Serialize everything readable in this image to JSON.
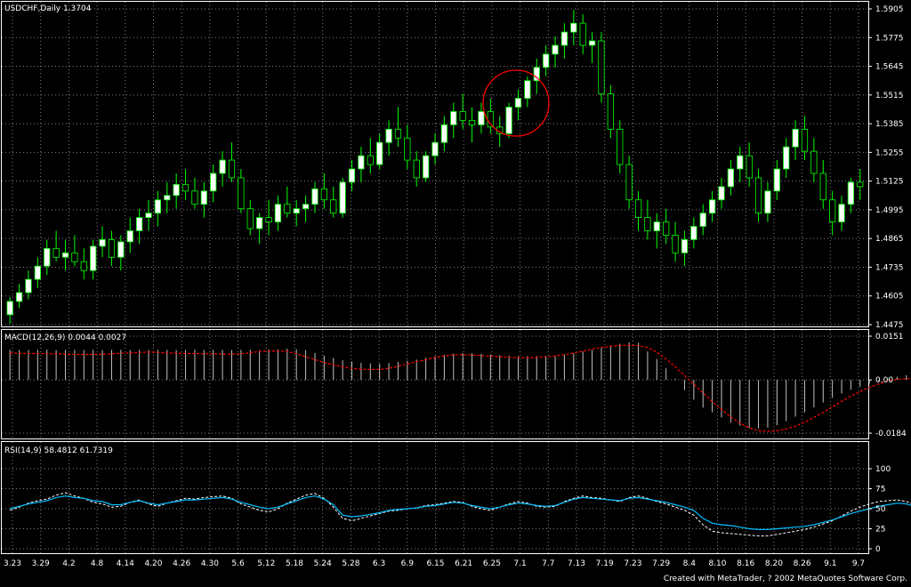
{
  "credit": "Created with MetaTrader, ? 2002 MetaQuotes Software Corp.",
  "colors": {
    "background": "#000000",
    "bull_candle": "#ffffff",
    "bear_candle": "#000000",
    "wick": "#00ff00",
    "grid": "#808080",
    "macd_histogram": "#c0c0c0",
    "macd_signal": "#ff0000",
    "rsi_line": "#00bfff",
    "rsi_signal": "#ffffff",
    "annotation_circle": "#ff0000"
  },
  "chart_data": [
    {
      "type": "candlestick",
      "label": "USDCHF,Daily  1.3704",
      "symbol": "USDCHF",
      "timeframe": "Daily",
      "last": "1.3704",
      "ylim": [
        1.4475,
        1.5905
      ],
      "y_ticks": [
        "1.5905",
        "1.5775",
        "1.5645",
        "1.5515",
        "1.5385",
        "1.5255",
        "1.5125",
        "1.4995",
        "1.4865",
        "1.4735",
        "1.4605",
        "1.4475"
      ],
      "x_ticks": [
        "3.23",
        "3.29",
        "4.2",
        "4.8",
        "4.14",
        "4.20",
        "4.26",
        "4.30",
        "5.6",
        "5.12",
        "5.18",
        "5.24",
        "5.28",
        "6.3",
        "6.9",
        "6.15",
        "6.21",
        "6.25",
        "7.1",
        "7.7",
        "7.13",
        "7.19",
        "7.23",
        "7.29",
        "8.4",
        "8.10",
        "8.16",
        "8.20",
        "8.26",
        "9.1",
        "9.7"
      ],
      "grid": true,
      "annotations": [
        {
          "shape": "circle",
          "around": "7.1"
        }
      ],
      "candles": [
        [
          1.452,
          1.46,
          1.448,
          1.458
        ],
        [
          1.458,
          1.466,
          1.455,
          1.462
        ],
        [
          1.462,
          1.472,
          1.459,
          1.468
        ],
        [
          1.468,
          1.478,
          1.464,
          1.474
        ],
        [
          1.474,
          1.486,
          1.47,
          1.482
        ],
        [
          1.482,
          1.49,
          1.476,
          1.478
        ],
        [
          1.478,
          1.486,
          1.472,
          1.48
        ],
        [
          1.48,
          1.488,
          1.474,
          1.476
        ],
        [
          1.476,
          1.482,
          1.468,
          1.472
        ],
        [
          1.472,
          1.486,
          1.468,
          1.483
        ],
        [
          1.483,
          1.492,
          1.478,
          1.486
        ],
        [
          1.486,
          1.49,
          1.474,
          1.478
        ],
        [
          1.478,
          1.488,
          1.472,
          1.485
        ],
        [
          1.485,
          1.496,
          1.48,
          1.49
        ],
        [
          1.49,
          1.5,
          1.484,
          1.496
        ],
        [
          1.496,
          1.504,
          1.49,
          1.498
        ],
        [
          1.498,
          1.508,
          1.492,
          1.504
        ],
        [
          1.504,
          1.512,
          1.498,
          1.506
        ],
        [
          1.506,
          1.516,
          1.5,
          1.511
        ],
        [
          1.511,
          1.518,
          1.504,
          1.508
        ],
        [
          1.508,
          1.514,
          1.5,
          1.502
        ],
        [
          1.502,
          1.512,
          1.496,
          1.508
        ],
        [
          1.508,
          1.52,
          1.503,
          1.516
        ],
        [
          1.516,
          1.526,
          1.51,
          1.522
        ],
        [
          1.522,
          1.53,
          1.512,
          1.514
        ],
        [
          1.514,
          1.518,
          1.498,
          1.5
        ],
        [
          1.5,
          1.504,
          1.488,
          1.491
        ],
        [
          1.491,
          1.498,
          1.484,
          1.496
        ],
        [
          1.496,
          1.504,
          1.488,
          1.494
        ],
        [
          1.494,
          1.506,
          1.49,
          1.502
        ],
        [
          1.502,
          1.51,
          1.496,
          1.498
        ],
        [
          1.498,
          1.504,
          1.492,
          1.5
        ],
        [
          1.5,
          1.506,
          1.494,
          1.502
        ],
        [
          1.502,
          1.512,
          1.498,
          1.509
        ],
        [
          1.509,
          1.516,
          1.5,
          1.504
        ],
        [
          1.504,
          1.51,
          1.496,
          1.498
        ],
        [
          1.498,
          1.514,
          1.496,
          1.512
        ],
        [
          1.512,
          1.522,
          1.508,
          1.518
        ],
        [
          1.518,
          1.528,
          1.512,
          1.524
        ],
        [
          1.524,
          1.532,
          1.516,
          1.52
        ],
        [
          1.52,
          1.534,
          1.518,
          1.53
        ],
        [
          1.53,
          1.54,
          1.524,
          1.536
        ],
        [
          1.536,
          1.546,
          1.528,
          1.532
        ],
        [
          1.532,
          1.538,
          1.518,
          1.522
        ],
        [
          1.522,
          1.526,
          1.51,
          1.514
        ],
        [
          1.514,
          1.526,
          1.512,
          1.524
        ],
        [
          1.524,
          1.534,
          1.52,
          1.53
        ],
        [
          1.53,
          1.542,
          1.526,
          1.538
        ],
        [
          1.538,
          1.548,
          1.532,
          1.544
        ],
        [
          1.544,
          1.552,
          1.536,
          1.54
        ],
        [
          1.54,
          1.546,
          1.53,
          1.538
        ],
        [
          1.538,
          1.548,
          1.534,
          1.544
        ],
        [
          1.544,
          1.55,
          1.534,
          1.537
        ],
        [
          1.537,
          1.542,
          1.528,
          1.534
        ],
        [
          1.534,
          1.548,
          1.532,
          1.546
        ],
        [
          1.546,
          1.554,
          1.54,
          1.55
        ],
        [
          1.55,
          1.56,
          1.546,
          1.558
        ],
        [
          1.558,
          1.568,
          1.552,
          1.564
        ],
        [
          1.564,
          1.574,
          1.56,
          1.57
        ],
        [
          1.57,
          1.578,
          1.564,
          1.574
        ],
        [
          1.574,
          1.584,
          1.568,
          1.58
        ],
        [
          1.58,
          1.59,
          1.574,
          1.584
        ],
        [
          1.584,
          1.588,
          1.57,
          1.574
        ],
        [
          1.574,
          1.58,
          1.566,
          1.576
        ],
        [
          1.576,
          1.58,
          1.548,
          1.552
        ],
        [
          1.552,
          1.556,
          1.532,
          1.536
        ],
        [
          1.536,
          1.54,
          1.516,
          1.52
        ],
        [
          1.52,
          1.524,
          1.5,
          1.504
        ],
        [
          1.504,
          1.508,
          1.49,
          1.496
        ],
        [
          1.496,
          1.504,
          1.486,
          1.49
        ],
        [
          1.49,
          1.498,
          1.482,
          1.494
        ],
        [
          1.494,
          1.5,
          1.484,
          1.488
        ],
        [
          1.488,
          1.494,
          1.476,
          1.48
        ],
        [
          1.48,
          1.49,
          1.474,
          1.486
        ],
        [
          1.486,
          1.496,
          1.482,
          1.492
        ],
        [
          1.492,
          1.502,
          1.488,
          1.498
        ],
        [
          1.498,
          1.508,
          1.494,
          1.504
        ],
        [
          1.504,
          1.514,
          1.5,
          1.51
        ],
        [
          1.51,
          1.522,
          1.506,
          1.518
        ],
        [
          1.518,
          1.528,
          1.512,
          1.524
        ],
        [
          1.524,
          1.53,
          1.51,
          1.514
        ],
        [
          1.514,
          1.518,
          1.494,
          1.498
        ],
        [
          1.498,
          1.512,
          1.494,
          1.508
        ],
        [
          1.508,
          1.522,
          1.504,
          1.518
        ],
        [
          1.518,
          1.532,
          1.514,
          1.528
        ],
        [
          1.528,
          1.54,
          1.522,
          1.536
        ],
        [
          1.536,
          1.542,
          1.522,
          1.526
        ],
        [
          1.526,
          1.532,
          1.512,
          1.516
        ],
        [
          1.516,
          1.522,
          1.5,
          1.504
        ],
        [
          1.504,
          1.508,
          1.488,
          1.494
        ],
        [
          1.494,
          1.506,
          1.49,
          1.502
        ],
        [
          1.502,
          1.514,
          1.498,
          1.512
        ],
        [
          1.512,
          1.518,
          1.504,
          1.51
        ]
      ]
    },
    {
      "type": "bar",
      "label": "MACD(12,26,9)  0.0044  0.0027",
      "name": "MACD",
      "params": "12,26,9",
      "value1": "0.0044",
      "value2": "0.0027",
      "ylim": [
        -0.0184,
        0.0151
      ],
      "y_ticks": [
        "0.0151",
        "0.00",
        "-0.0184"
      ],
      "histogram": [
        0.0104,
        0.0104,
        0.0103,
        0.0104,
        0.0104,
        0.0103,
        0.0104,
        0.0104,
        0.0103,
        0.0104,
        0.0103,
        0.0104,
        0.0104,
        0.0103,
        0.0104,
        0.0103,
        0.0104,
        0.0104,
        0.0103,
        0.0104,
        0.0104,
        0.0103,
        0.0104,
        0.0104,
        0.0103,
        0.0104,
        0.0104,
        0.0103,
        0.0105,
        0.0105,
        0.0108,
        0.0106,
        0.0103,
        0.0093,
        0.0084,
        0.0076,
        0.0068,
        0.0063,
        0.0059,
        0.0057,
        0.0056,
        0.0058,
        0.0062,
        0.0066,
        0.007,
        0.0076,
        0.0082,
        0.0087,
        0.0091,
        0.0092,
        0.0092,
        0.009,
        0.0088,
        0.0086,
        0.0084,
        0.0082,
        0.0082,
        0.0082,
        0.0083,
        0.0084,
        0.0088,
        0.0092,
        0.0098,
        0.0103,
        0.0112,
        0.0119,
        0.0125,
        0.013,
        0.0128,
        0.0098,
        0.0072,
        0.004,
        0.0004,
        -0.0035,
        -0.0068,
        -0.0096,
        -0.0112,
        -0.013,
        -0.0148,
        -0.0158,
        -0.0166,
        -0.0168,
        -0.0165,
        -0.0157,
        -0.0143,
        -0.0127,
        -0.0112,
        -0.0095,
        -0.0078,
        -0.0062,
        -0.0047,
        -0.0034,
        -0.0024,
        -0.0012,
        -0.0004,
        0.0004,
        0.0011,
        0.0016,
        0.0015,
        0.0013,
        0.0011
      ],
      "signal": [
        0.0093,
        0.0092,
        0.0091,
        0.0091,
        0.009,
        0.009,
        0.0089,
        0.0088,
        0.0088,
        0.0088,
        0.0089,
        0.009,
        0.0092,
        0.0093,
        0.0095,
        0.0096,
        0.0095,
        0.0093,
        0.0092,
        0.0091,
        0.0091,
        0.009,
        0.009,
        0.0089,
        0.0089,
        0.009,
        0.0094,
        0.0098,
        0.01,
        0.01,
        0.0098,
        0.009,
        0.008,
        0.007,
        0.006,
        0.0052,
        0.0045,
        0.004,
        0.0037,
        0.0036,
        0.0036,
        0.004,
        0.0047,
        0.0055,
        0.0063,
        0.007,
        0.0077,
        0.0083,
        0.0086,
        0.0087,
        0.0086,
        0.0084,
        0.0082,
        0.008,
        0.0078,
        0.0077,
        0.0077,
        0.0078,
        0.008,
        0.0083,
        0.0087,
        0.0093,
        0.0099,
        0.0106,
        0.0112,
        0.0116,
        0.0119,
        0.012,
        0.0118,
        0.0112,
        0.0096,
        0.0072,
        0.0045,
        0.0015,
        -0.0015,
        -0.0045,
        -0.0075,
        -0.0102,
        -0.0128,
        -0.015,
        -0.0166,
        -0.0175,
        -0.0178,
        -0.0176,
        -0.017,
        -0.016,
        -0.0146,
        -0.013,
        -0.0112,
        -0.0093,
        -0.0074,
        -0.0056,
        -0.004,
        -0.0026,
        -0.0014,
        -0.0004,
        0.0002,
        0.0004,
        0.0004,
        0.0003,
        0.0002
      ]
    },
    {
      "type": "line",
      "label": "RSI(14,9)  58.4812  61.7319",
      "name": "RSI",
      "params": "14,9",
      "value1": "58.4812",
      "value2": "61.7319",
      "ylim": [
        0,
        100
      ],
      "y_ticks": [
        "100",
        "75",
        "50",
        "25",
        "0"
      ],
      "rsi": [
        50,
        53,
        56,
        58,
        60,
        64,
        66,
        64,
        63,
        60,
        59,
        55,
        55,
        58,
        60,
        57,
        55,
        57,
        59,
        61,
        61,
        62,
        63,
        64,
        62,
        58,
        55,
        52,
        50,
        52,
        56,
        60,
        64,
        66,
        62,
        55,
        42,
        40,
        41,
        43,
        45,
        48,
        49,
        50,
        51,
        53,
        54,
        56,
        58,
        57,
        54,
        52,
        50,
        52,
        55,
        57,
        56,
        54,
        53,
        54,
        58,
        62,
        64,
        63,
        62,
        61,
        60,
        63,
        64,
        62,
        60,
        58,
        55,
        52,
        48,
        38,
        32,
        30,
        29,
        27,
        25,
        24,
        24,
        25,
        26,
        27,
        28,
        30,
        33,
        36,
        40,
        44,
        47,
        50,
        53,
        55,
        57,
        56,
        53,
        51,
        48,
        45,
        45,
        46,
        47
      ],
      "rsi_signal": [
        48,
        52,
        57,
        60,
        62,
        67,
        70,
        66,
        63,
        58,
        56,
        52,
        53,
        58,
        61,
        56,
        53,
        57,
        60,
        63,
        62,
        64,
        65,
        66,
        63,
        56,
        52,
        48,
        46,
        50,
        57,
        62,
        67,
        69,
        63,
        52,
        38,
        35,
        38,
        41,
        44,
        47,
        48,
        50,
        51,
        54,
        55,
        57,
        59,
        58,
        53,
        50,
        48,
        52,
        56,
        59,
        57,
        53,
        52,
        53,
        59,
        63,
        66,
        64,
        63,
        61,
        59,
        64,
        66,
        63,
        59,
        56,
        52,
        48,
        42,
        30,
        22,
        20,
        19,
        18,
        17,
        16,
        16,
        18,
        20,
        22,
        24,
        27,
        31,
        35,
        41,
        47,
        52,
        56,
        59,
        60,
        61,
        59,
        55,
        52,
        47,
        42,
        41,
        43,
        45
      ]
    }
  ]
}
